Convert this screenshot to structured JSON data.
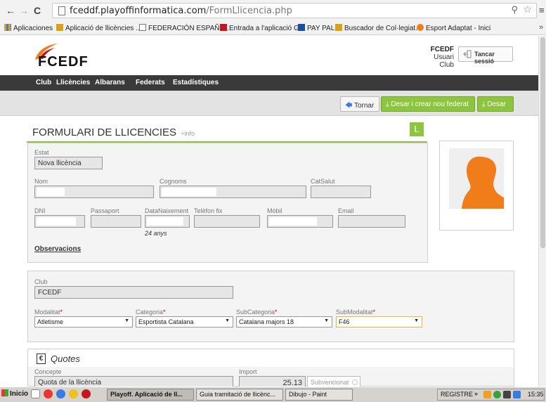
{
  "browser": {
    "url_domain": "fceddf.playoffinformatica.com",
    "url_path": "/FormLlicencia.php",
    "bookmarks": [
      {
        "label": "Aplicaciones",
        "color": "#e0a020"
      },
      {
        "label": "Aplicació de llicències ...",
        "color": "#d9a21b"
      },
      {
        "label": "FEDERACIÓN ESPAÑO...",
        "color": "#ffffff"
      },
      {
        "label": "Entrada a l'aplicació G...",
        "color": "#c4161c"
      },
      {
        "label": "PAY PAL",
        "color": "#1c4fa0"
      },
      {
        "label": "Buscador de Col·legiat...",
        "color": "#d9a21b"
      },
      {
        "label": "Esport Adaptat - Inici",
        "color": "#f07d1a"
      }
    ]
  },
  "header": {
    "logo_text": "FCEDF",
    "user_name": "FCEDF",
    "user_role": "Usuari Club",
    "logout_label": "Tancar sessió"
  },
  "nav": {
    "items": [
      "Club",
      "Llicències",
      "Albarans",
      "Federats",
      "Estadístiques"
    ]
  },
  "actions": {
    "back_label": "Tornar",
    "save_new_label": "Desar i crear nou federat",
    "save_label": "Desar"
  },
  "form": {
    "title": "FORMULARI DE LLICENCIES",
    "info_link": "+info",
    "badge": "L",
    "estat_label": "Estat",
    "estat_value": "Nova llicència",
    "nom_label": "Nom",
    "cognoms_label": "Cognoms",
    "catsalut_label": "CatSalut",
    "dni_label": "DNI",
    "passaport_label": "Passaport",
    "datanaixement_label": "DataNaixement",
    "telefon_label": "Telèfon fix",
    "mobil_label": "Mòbil",
    "email_label": "Email",
    "age_hint": "24 anys",
    "observacions_label": "Observacions",
    "club_label": "Club",
    "club_value": "FCEDF",
    "modalitat_label": "Modalitat",
    "modalitat_value": "Atletisme",
    "categoria_label": "Categoria",
    "categoria_value": "Esportista Catalana",
    "subcategoria_label": "SubCategoria",
    "subcategoria_value": "Catalana majors 18",
    "submodalitat_label": "SubModalitat",
    "submodalitat_value": "F46",
    "required_mark": "*"
  },
  "quotes": {
    "title": "Quotes",
    "concepte_label": "Concepte",
    "concepte_value": "Quota de la llicència",
    "import_label": "Import",
    "import_value": "25.13",
    "subvencionat_label": "Subvencionat"
  },
  "taskbar": {
    "start_label": "Inicio",
    "tasks": [
      "Playoff. Aplicació de ll...",
      "Guia tramitació de llicènc...",
      "Dibujo - Paint"
    ],
    "tray_label": "REGISTRE",
    "clock": "15:35"
  },
  "colors": {
    "accent_green": "#8cc63e",
    "nav_dark": "#3a3a3a",
    "avatar_orange": "#f07d1a"
  }
}
